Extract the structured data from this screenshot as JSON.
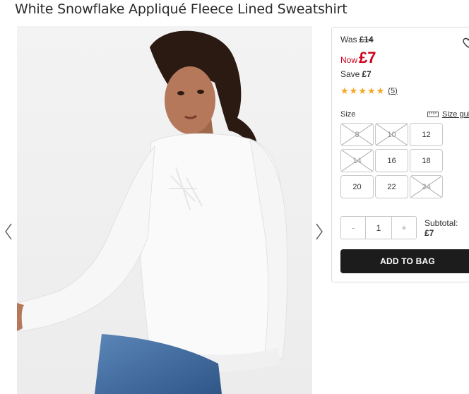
{
  "product": {
    "title": "White Snowflake Appliqué Fleece Lined Sweatshirt"
  },
  "gallery": {
    "prev_icon": "chevron-left-icon",
    "next_icon": "chevron-right-icon"
  },
  "pricing": {
    "was_label": "Was",
    "was_price": "£14",
    "now_label": "Now",
    "now_price": "£7",
    "save_label": "Save",
    "save_amount": "£7",
    "accent_color": "#d0021b"
  },
  "wishlist": {
    "icon": "heart-icon"
  },
  "rating": {
    "stars": 5,
    "max": 5,
    "review_count": "(5)",
    "star_color": "#f5a623"
  },
  "size_selector": {
    "label": "Size",
    "guide_icon": "ruler-icon",
    "guide_label": "Size guide",
    "options": [
      {
        "label": "8",
        "available": false
      },
      {
        "label": "10",
        "available": false
      },
      {
        "label": "12",
        "available": true
      },
      {
        "label": "14",
        "available": false
      },
      {
        "label": "16",
        "available": true
      },
      {
        "label": "18",
        "available": true
      },
      {
        "label": "20",
        "available": true
      },
      {
        "label": "22",
        "available": true
      },
      {
        "label": "24",
        "available": false
      }
    ]
  },
  "quantity": {
    "minus": "-",
    "value": "1",
    "plus": "+"
  },
  "subtotal": {
    "label": "Subtotal:",
    "amount": "£7"
  },
  "add_to_bag": {
    "label": "ADD TO BAG",
    "color": "#1c1c1c"
  }
}
